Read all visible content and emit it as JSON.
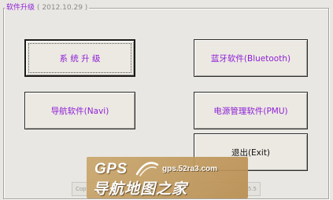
{
  "group": {
    "title": "软件升级",
    "date": "( 2012.10.29 )"
  },
  "buttons": {
    "system_upgrade": "系 统 升 级",
    "bluetooth": "蓝牙软件(Bluetooth)",
    "navi": "导航软件(Navi)",
    "pmu": "电源管理软件(PMU)",
    "exit": "退出(Exit)"
  },
  "footer": {
    "left": "Cop",
    "right": "5.5"
  },
  "watermark": {
    "brand": "GPS",
    "site": "gps.52ra3.com",
    "chinese": "导航地图之家"
  },
  "colors": {
    "accent_text": "#8e1fd6",
    "watermark_bg": "#c19a5e"
  }
}
